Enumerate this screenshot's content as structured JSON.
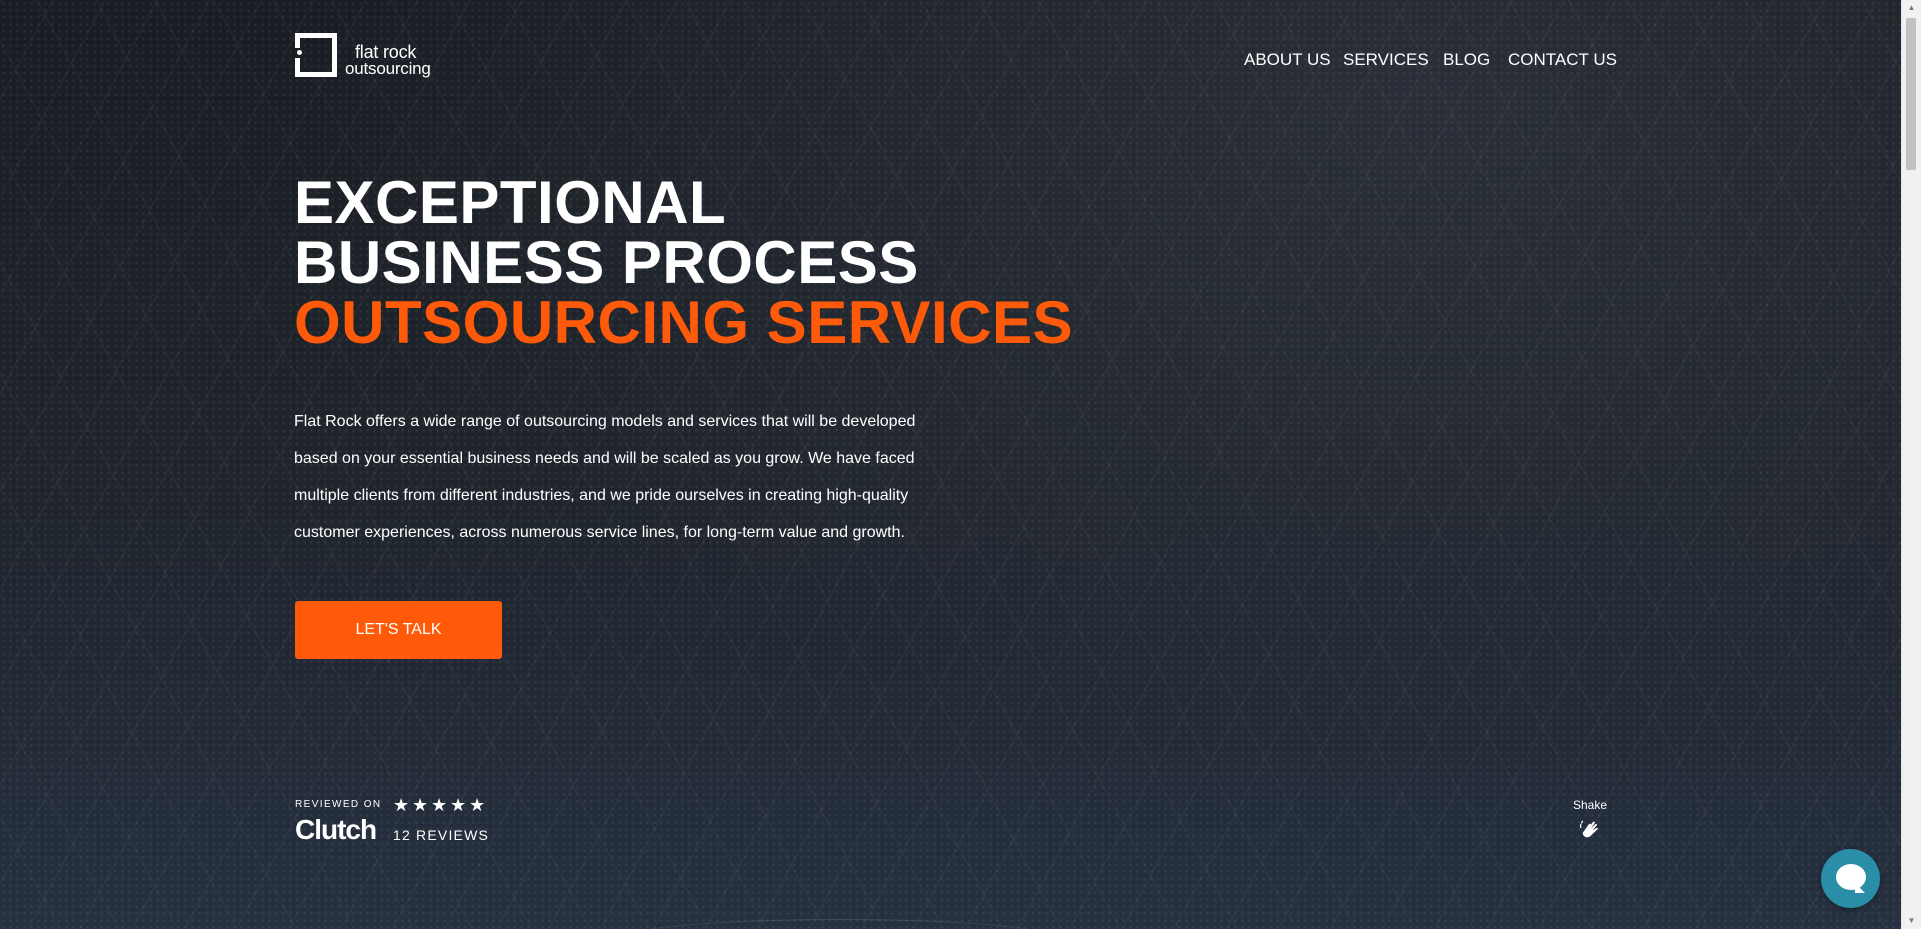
{
  "brand": {
    "logo_line1": "flat rock",
    "logo_line2": "outsourcing",
    "accent_color": "#ff5a0a",
    "chat_color": "#2a8ea9"
  },
  "nav": {
    "items": [
      {
        "label": "ABOUT US"
      },
      {
        "label": "SERVICES"
      },
      {
        "label": "BLOG"
      },
      {
        "label": "CONTACT US"
      }
    ]
  },
  "hero": {
    "line1": "EXCEPTIONAL",
    "line2": "BUSINESS PROCESS",
    "line3": "OUTSOURCING SERVICES",
    "description": "Flat Rock offers a wide range of outsourcing models and services that will be developed based on your essential business needs and will be scaled as you grow. We have faced multiple clients from different industries, and we pride ourselves in creating high-quality customer experiences, across numerous service lines, for long-term value and growth.",
    "cta_label": "LET'S TALK"
  },
  "review": {
    "label": "REVIEWED ON",
    "platform": "Clutch",
    "rating": 5,
    "count_text": "12 REVIEWS",
    "star_icon": "star-icon"
  },
  "shake": {
    "label": "Shake",
    "icon": "waving-hand-icon"
  },
  "chat": {
    "icon": "chat-bubble-icon"
  }
}
